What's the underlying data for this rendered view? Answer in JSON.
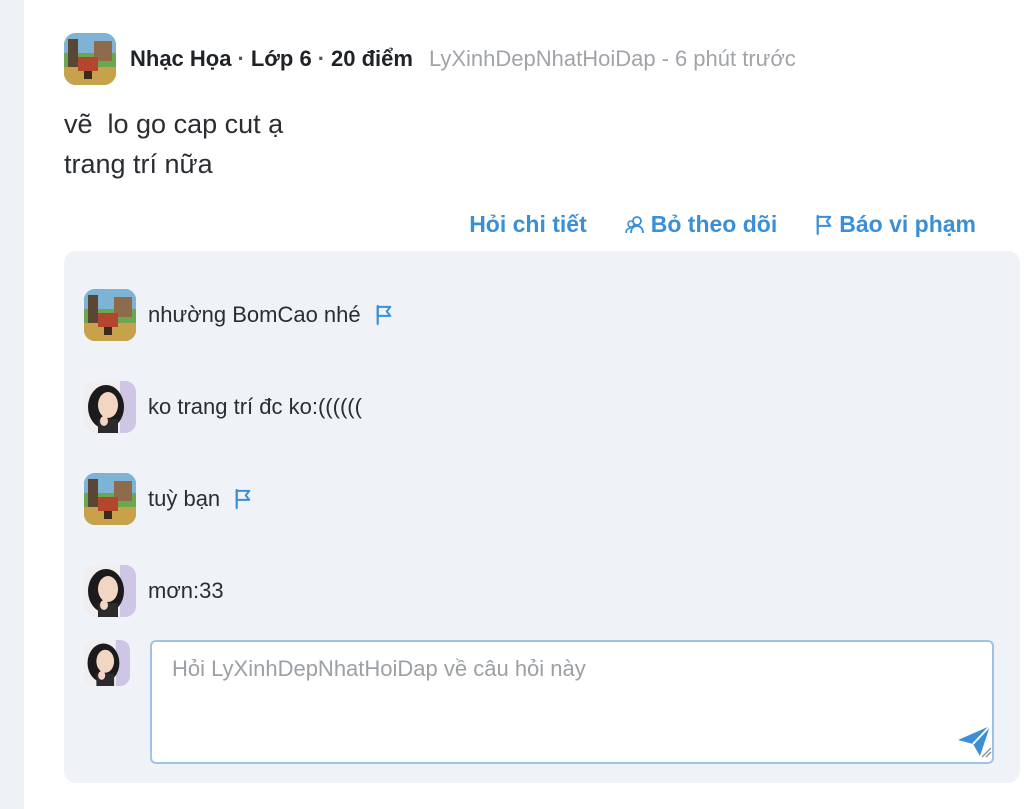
{
  "post": {
    "author": "Nhạc Họa",
    "grade": "Lớp 6",
    "points": "20 điểm",
    "asked_to": "LyXinhDepNhatHoiDap",
    "separator": "-",
    "time": "6 phút trước",
    "body_lines": [
      "vẽ  lo go cap cut ạ",
      "trang trí nữa"
    ]
  },
  "actions": {
    "ask_detail": "Hỏi chi tiết",
    "unfollow": "Bỏ theo dõi",
    "report": "Báo vi phạm"
  },
  "comments": [
    {
      "text": "nhường BomCao nhé",
      "avatar": "game-avatar",
      "has_flag": true
    },
    {
      "text": "ko trang trí đc ko:((((((",
      "avatar": "girl-avatar",
      "has_flag": false
    },
    {
      "text": "tuỳ bạn",
      "avatar": "game-avatar",
      "has_flag": true
    },
    {
      "text": "mơn:33",
      "avatar": "girl-avatar",
      "has_flag": false
    }
  ],
  "reply": {
    "placeholder": "Hỏi LyXinhDepNhatHoiDap về câu hỏi này"
  },
  "colors": {
    "link_blue": "#3a8fd6",
    "comment_bg": "#eff2f7",
    "input_border": "#9fc3e6"
  },
  "icons": [
    "users-icon",
    "flag-icon",
    "send-icon"
  ]
}
